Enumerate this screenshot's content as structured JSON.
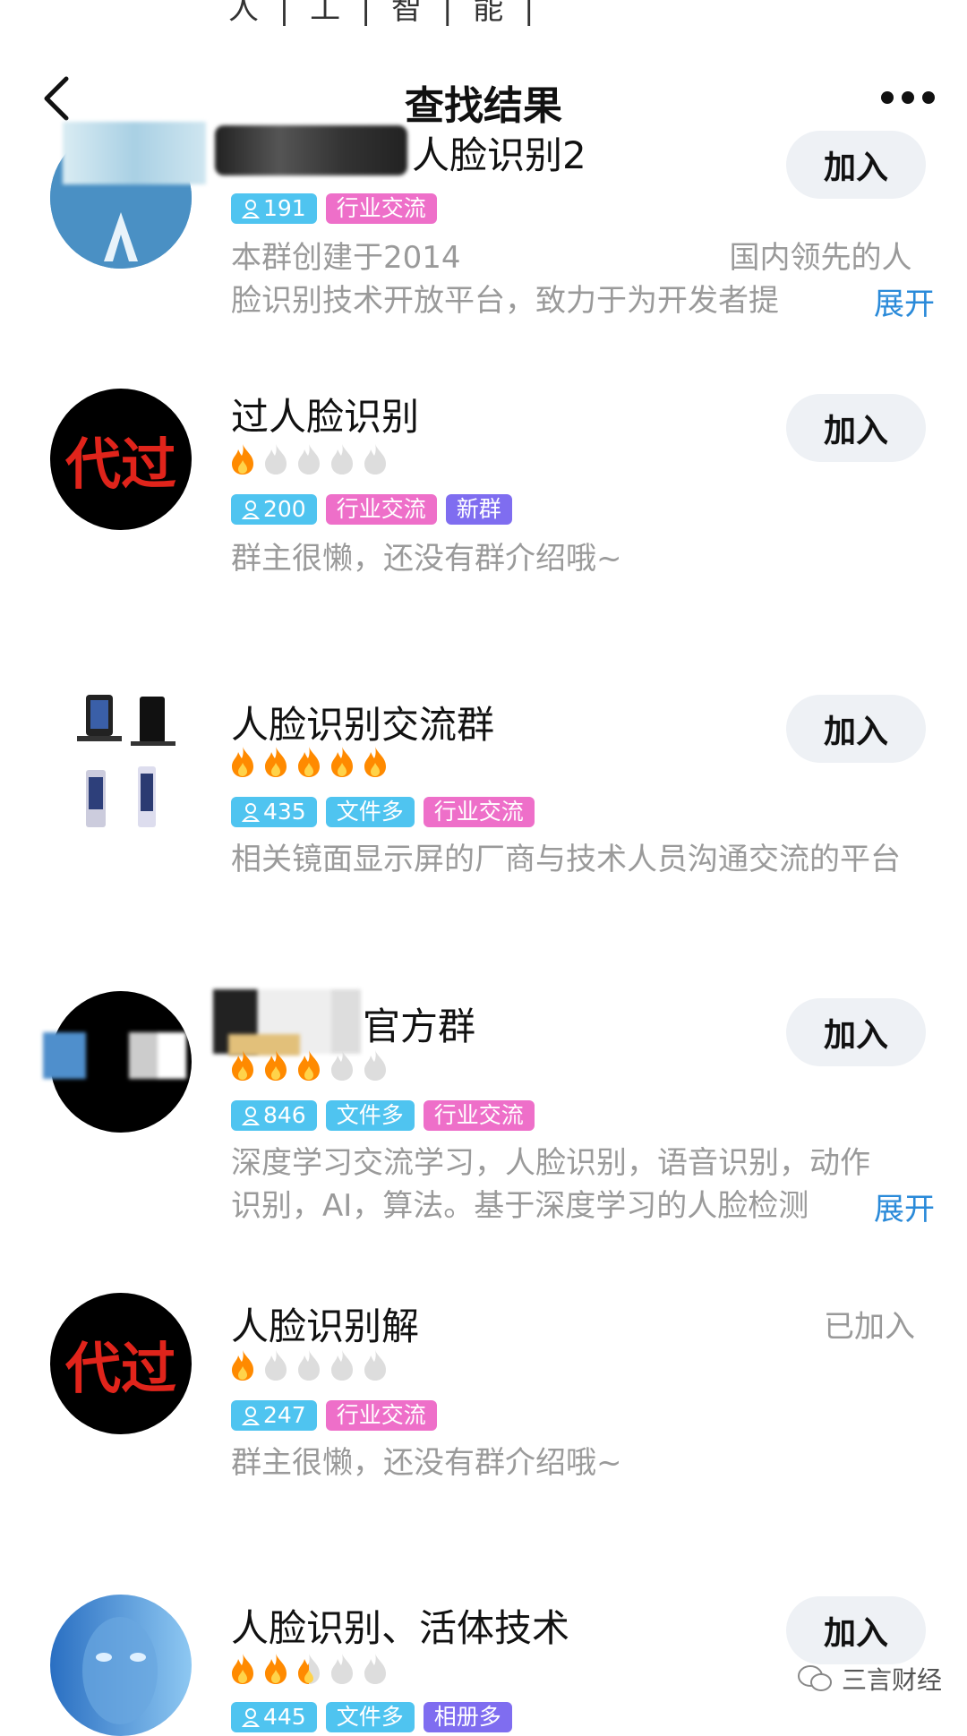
{
  "header": {
    "top_cut": "人 | 工 | 智 | 能 |",
    "title": "查找结果"
  },
  "colors": {
    "accent": "#2a8ad9",
    "member_tag": "#4fc4f0",
    "industry_tag": "#ee6fc9",
    "new_tag": "#7f6df0",
    "flame_on": "#ff8a00",
    "flame_off": "#dddddd"
  },
  "groups": [
    {
      "name": "人脸识别2",
      "members": "191",
      "tags": [
        "行业交流"
      ],
      "rating": null,
      "desc_l1": "本群创建于2014",
      "desc_l1b": "国内领先的人",
      "desc_l2": "脸识别技术开放平台，致力于为开发者提",
      "expand": "展开",
      "action": "加入"
    },
    {
      "name": "过人脸识别",
      "members": "200",
      "tags": [
        "行业交流",
        "新群"
      ],
      "rating": 1,
      "avatar_text": "代过",
      "desc": "群主很懒，还没有群介绍哦~",
      "action": "加入"
    },
    {
      "name": "人脸识别交流群",
      "members": "435",
      "tags": [
        "文件多",
        "行业交流"
      ],
      "rating": 5,
      "desc": "相关镜面显示屏的厂商与技术人员沟通交流的平台",
      "action": "加入"
    },
    {
      "name": "官方群",
      "members": "846",
      "tags": [
        "文件多",
        "行业交流"
      ],
      "rating": 3,
      "desc_l1": "深度学习交流学习，人脸识别，语音识别，动作",
      "desc_l2": "识别，AI，算法。基于深度学习的人脸检测",
      "expand": "展开",
      "action": "加入"
    },
    {
      "name": "人脸识别解",
      "members": "247",
      "tags": [
        "行业交流"
      ],
      "rating": 1,
      "avatar_text": "代过",
      "desc": "群主很懒，还没有群介绍哦~",
      "action": "已加入"
    },
    {
      "name": "人脸识别、活体技术",
      "members": "445",
      "tags": [
        "文件多",
        "相册多"
      ],
      "rating": 2.5,
      "action": "加入"
    }
  ],
  "watermark": "三言财经"
}
